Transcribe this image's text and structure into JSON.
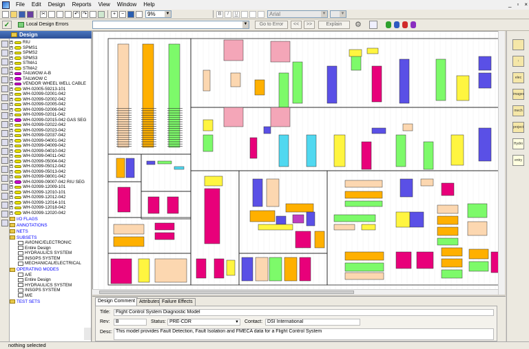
{
  "menubar": {
    "items": [
      "File",
      "Edit",
      "Design",
      "Reports",
      "View",
      "Window",
      "Help"
    ],
    "window_controls": [
      "_",
      "▫",
      "×"
    ]
  },
  "toolbar1": {
    "zoom_value": "9%",
    "font_value": "Arial",
    "style_buttons": [
      "B",
      "I",
      "U"
    ]
  },
  "toolbar2": {
    "local_design_errors_label": "Local Design Errors",
    "goto_error_label": "Go to Error",
    "prev_label": "<<",
    "next_label": ">>",
    "explain_label": "Explain"
  },
  "left_panel": {
    "header": "Design",
    "nodes": [
      {
        "label": "RIU",
        "icon": "yellow"
      },
      {
        "label": "SPMS1",
        "icon": "yellow"
      },
      {
        "label": "SPMS2",
        "icon": "yellow"
      },
      {
        "label": "SPMS3",
        "icon": "yellow"
      },
      {
        "label": "STMA1",
        "icon": "yellow"
      },
      {
        "label": "STMA2",
        "icon": "yellow"
      },
      {
        "label": "TAILWOW A-B",
        "icon": "magenta"
      },
      {
        "label": "TAILWOW C",
        "icon": "magenta"
      },
      {
        "label": "VENDOR WHEEL WELL CABLE",
        "icon": "magenta"
      },
      {
        "label": "WH-02005-59213-101",
        "icon": "yellow"
      },
      {
        "label": "WH-02099-02001-042",
        "icon": "yellow"
      },
      {
        "label": "WH-02099-02002-042",
        "icon": "yellow"
      },
      {
        "label": "WH-02099-02005-042",
        "icon": "yellow"
      },
      {
        "label": "WH-02099-02006-042",
        "icon": "yellow"
      },
      {
        "label": "WH-02099-02011-042",
        "icon": "yellow"
      },
      {
        "label": "WH-02099-02015-042 GAS SEG",
        "icon": "magenta"
      },
      {
        "label": "WH-02099-02022-042",
        "icon": "yellow"
      },
      {
        "label": "WH-02099-02023-042",
        "icon": "yellow"
      },
      {
        "label": "WH-02099-02037-042",
        "icon": "yellow"
      },
      {
        "label": "WH-02099-04001-042",
        "icon": "yellow"
      },
      {
        "label": "WH-02099-04009-042",
        "icon": "yellow"
      },
      {
        "label": "WH-02099-04010-042",
        "icon": "yellow"
      },
      {
        "label": "WH-02099-04011-042",
        "icon": "yellow"
      },
      {
        "label": "WH-02099-05004-042",
        "icon": "yellow"
      },
      {
        "label": "WH-02099-05012-042",
        "icon": "yellow"
      },
      {
        "label": "WH-02099-05013-042",
        "icon": "yellow"
      },
      {
        "label": "WH-02099-08001-042",
        "icon": "yellow"
      },
      {
        "label": "WH-02099-09007-042 RIU SEG",
        "icon": "magenta"
      },
      {
        "label": "WH-02099-12009-101",
        "icon": "yellow"
      },
      {
        "label": "WH-02099-12010-101",
        "icon": "yellow"
      },
      {
        "label": "WH-02099-12012-042",
        "icon": "yellow"
      },
      {
        "label": "WH-02099-12014-101",
        "icon": "yellow"
      },
      {
        "label": "WH-02099-12018-042",
        "icon": "yellow"
      },
      {
        "label": "WH-02099-12020-042",
        "icon": "yellow"
      }
    ],
    "sections": [
      {
        "label": "I/O FLAGS",
        "children": []
      },
      {
        "label": "ANNOTATIONS",
        "children": []
      },
      {
        "label": "NETS",
        "children": []
      },
      {
        "label": "SUBSETS",
        "children": [
          "AVIONIC/ELECTRONIC",
          "Entire Design",
          "HYDRAULICS SYSTEM",
          "INSGPS SYSTEM",
          "MECHANICAL/ELECTRICAL"
        ]
      },
      {
        "label": "OPERATING MODES",
        "children": [
          "A/E",
          "Entire Design",
          "HYDRAULICS SYSTEM",
          "INSGPS SYSTEM",
          "M/E"
        ]
      },
      {
        "label": "TEST SETS",
        "children": []
      }
    ]
  },
  "right_palette": [
    "",
    "",
    "elec",
    "images",
    "mech",
    "project",
    "Hydro",
    "entry"
  ],
  "bottom_panel": {
    "tabs": [
      "Design Comment",
      "Attributes",
      "Failure Effects"
    ],
    "title_label": "Title:",
    "title_value": "Flight Control System Diagnostic Model",
    "rev_label": "Rev:",
    "rev_value": "B",
    "status_label": "Status:",
    "status_value": "PRE-CDR",
    "contact_label": "Contact:",
    "contact_value": "DSI International",
    "desc_label": "Desc:",
    "desc_value": "This model provides Fault Detection, Fault Isolation and FMECA data for a Flight Control System"
  },
  "statusbar": {
    "text": "nothing selected"
  },
  "colors": {
    "peach": "#fcd7b0",
    "orange": "#ffb000",
    "green": "#7dfa6a",
    "blue": "#5a50e6",
    "cyan": "#50d8f0",
    "yellow": "#fff540",
    "magenta": "#e8007a",
    "purple": "#c03cc0",
    "pink": "#f4a6b8"
  }
}
